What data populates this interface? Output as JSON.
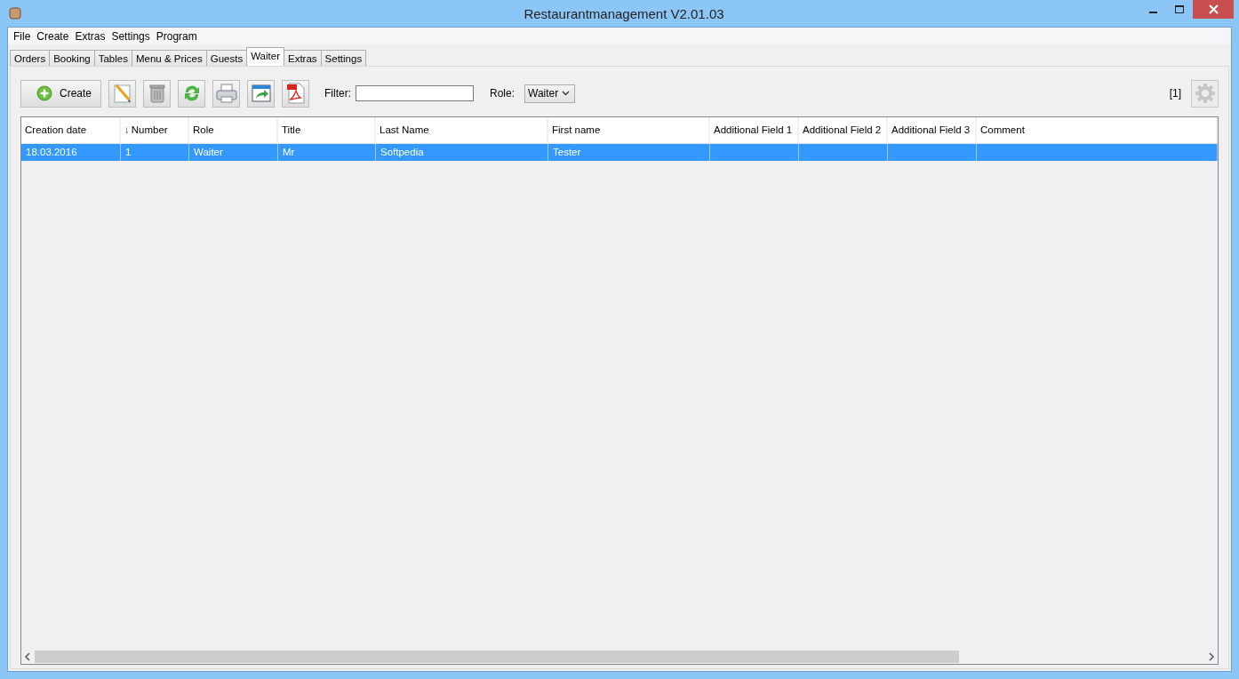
{
  "window": {
    "title": "Restaurantmanagement V2.01.03"
  },
  "menu": [
    "File",
    "Create",
    "Extras",
    "Settings",
    "Program"
  ],
  "tabs": [
    {
      "label": "Orders",
      "selected": false
    },
    {
      "label": "Booking",
      "selected": false
    },
    {
      "label": "Tables",
      "selected": false
    },
    {
      "label": "Menu & Prices",
      "selected": false
    },
    {
      "label": "Guests",
      "selected": false
    },
    {
      "label": "Waiter",
      "selected": true
    },
    {
      "label": "Extras",
      "selected": false
    },
    {
      "label": "Settings",
      "selected": false
    }
  ],
  "toolbar": {
    "create_label": "Create",
    "filter_label": "Filter:",
    "role_label": "Role:",
    "role_value": "Waiter",
    "count": "[1]"
  },
  "table": {
    "columns": [
      {
        "label": "Creation date"
      },
      {
        "label": "Number",
        "sort_arrow": "↓"
      },
      {
        "label": "Role"
      },
      {
        "label": "Title"
      },
      {
        "label": "Last Name"
      },
      {
        "label": "First name"
      },
      {
        "label": "Additional Field 1"
      },
      {
        "label": "Additional Field 2"
      },
      {
        "label": "Additional Field 3"
      },
      {
        "label": "Comment"
      }
    ],
    "rows": [
      {
        "selected": true,
        "cells": [
          "18.03.2016",
          "1",
          "Waiter",
          "Mr",
          "Softpedia",
          "Tester",
          "",
          "",
          "",
          ""
        ]
      }
    ]
  }
}
